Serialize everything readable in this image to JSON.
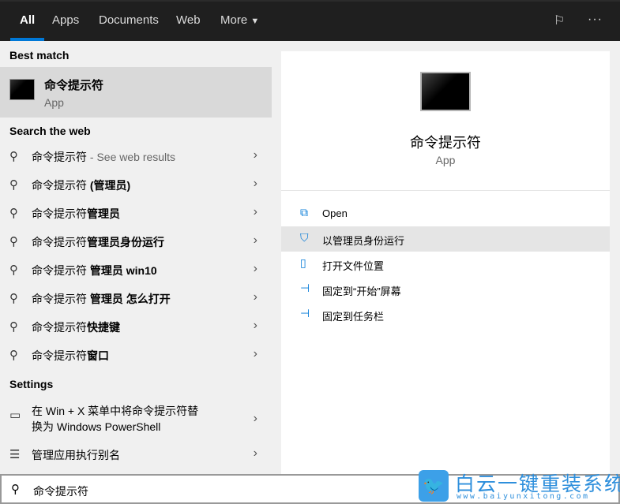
{
  "tabs": [
    "All",
    "Apps",
    "Documents",
    "Web",
    "More"
  ],
  "active_tab": "All",
  "top_icons": {
    "feedback": "feedback-icon",
    "more": "more-icon"
  },
  "left": {
    "best_match_label": "Best match",
    "best_match": {
      "title": "命令提示符",
      "subtitle": "App"
    },
    "search_web_label": "Search the web",
    "web_results": [
      {
        "prefix": "命令提示符",
        "bold": "",
        "suffix": " - See web results"
      },
      {
        "prefix": "命令提示符 ",
        "bold": "(管理员)",
        "suffix": ""
      },
      {
        "prefix": "命令提示符",
        "bold": "管理员",
        "suffix": ""
      },
      {
        "prefix": "命令提示符",
        "bold": "管理员身份运行",
        "suffix": ""
      },
      {
        "prefix": "命令提示符 ",
        "bold": "管理员 win10",
        "suffix": ""
      },
      {
        "prefix": "命令提示符 ",
        "bold": "管理员 怎么打开",
        "suffix": ""
      },
      {
        "prefix": "命令提示符",
        "bold": "快捷键",
        "suffix": ""
      },
      {
        "prefix": "命令提示符",
        "bold": "窗口",
        "suffix": ""
      }
    ],
    "settings_label": "Settings",
    "settings": [
      {
        "line1": "在 Win + X 菜单中将命令提示符替",
        "line2": "换为 Windows PowerShell"
      },
      {
        "line1": "管理应用执行别名"
      }
    ]
  },
  "right": {
    "title": "命令提示符",
    "subtitle": "App",
    "actions": [
      "Open",
      "以管理员身份运行",
      "打开文件位置",
      "固定到“开始”屏幕",
      "固定到任务栏"
    ]
  },
  "search": {
    "value": "命令提示符"
  },
  "watermark": {
    "name": "白云一键重装系统",
    "url": "www.baiyunxitong.com"
  },
  "colors": {
    "accent": "#0078d7",
    "topbar": "#1f1f1f",
    "highlight": "#d9d9d9"
  }
}
